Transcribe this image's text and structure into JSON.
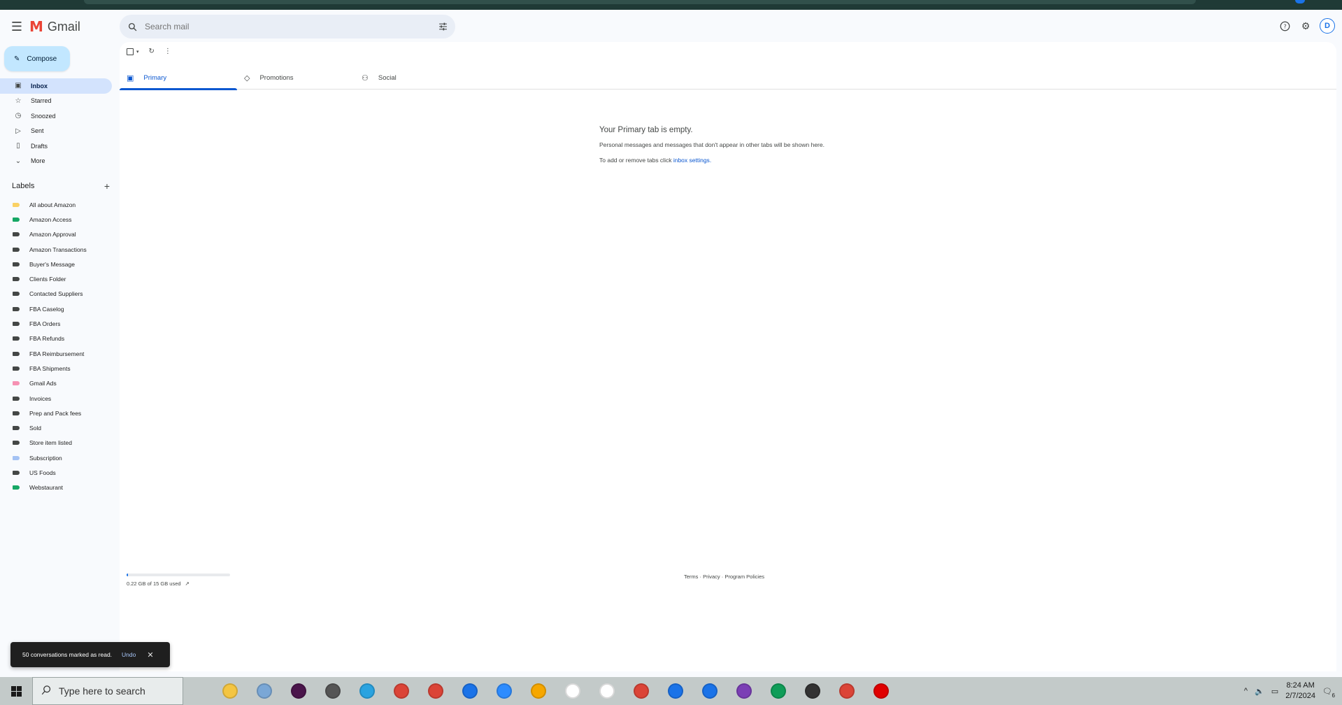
{
  "header": {
    "app_name": "Gmail",
    "search_placeholder": "Search mail",
    "avatar_letter": "D"
  },
  "sidebar": {
    "compose_label": "Compose",
    "nav": [
      {
        "label": "Inbox",
        "icon": "inbox-icon"
      },
      {
        "label": "Starred",
        "icon": "star-icon"
      },
      {
        "label": "Snoozed",
        "icon": "clock-icon"
      },
      {
        "label": "Sent",
        "icon": "send-icon"
      },
      {
        "label": "Drafts",
        "icon": "draft-icon"
      },
      {
        "label": "More",
        "icon": "chevron-down-icon"
      }
    ],
    "labels_title": "Labels",
    "labels": [
      {
        "name": "All about Amazon",
        "color": "#fad165"
      },
      {
        "name": "Amazon Access",
        "color": "#16a765"
      },
      {
        "name": "Amazon Approval",
        "color": "#444746"
      },
      {
        "name": "Amazon Transactions",
        "color": "#444746"
      },
      {
        "name": "Buyer's Message",
        "color": "#444746"
      },
      {
        "name": "Clients Folder",
        "color": "#444746"
      },
      {
        "name": "Contacted Suppliers",
        "color": "#444746"
      },
      {
        "name": "FBA Caselog",
        "color": "#444746"
      },
      {
        "name": "FBA Orders",
        "color": "#444746"
      },
      {
        "name": "FBA Refunds",
        "color": "#444746"
      },
      {
        "name": "FBA Reimbursement",
        "color": "#444746"
      },
      {
        "name": "FBA Shipments",
        "color": "#444746"
      },
      {
        "name": "Gmail Ads",
        "color": "#f691b3"
      },
      {
        "name": "Invoices",
        "color": "#444746"
      },
      {
        "name": "Prep and Pack fees",
        "color": "#444746"
      },
      {
        "name": "Sold",
        "color": "#444746"
      },
      {
        "name": "Store item listed",
        "color": "#444746"
      },
      {
        "name": "Subscription",
        "color": "#a4c2f4"
      },
      {
        "name": "US Foods",
        "color": "#444746"
      },
      {
        "name": "Webstaurant",
        "color": "#16a765"
      }
    ]
  },
  "tabs": [
    {
      "label": "Primary",
      "icon": "inbox-icon"
    },
    {
      "label": "Promotions",
      "icon": "tag-icon"
    },
    {
      "label": "Social",
      "icon": "people-icon"
    }
  ],
  "empty_state": {
    "title": "Your Primary tab is empty.",
    "description": "Personal messages and messages that don't appear in other tabs will be shown here.",
    "settings_prefix": "To add or remove tabs click ",
    "settings_link": "inbox settings",
    "settings_suffix": "."
  },
  "storage": {
    "text": "0.22 GB of 15 GB used",
    "fraction": 0.015
  },
  "footer": {
    "links": "Terms · Privacy · Program Policies"
  },
  "snackbar": {
    "message": "50 conversations marked as read.",
    "undo": "Undo"
  },
  "taskbar": {
    "search_placeholder": "Type here to search",
    "time": "8:24 AM",
    "date": "2/7/2024",
    "notification_count": "6",
    "apps": [
      {
        "name": "file-explorer-icon",
        "color": "#f4c542"
      },
      {
        "name": "notepad-icon",
        "color": "#7aa7d6"
      },
      {
        "name": "slack-icon",
        "color": "#4a154b"
      },
      {
        "name": "calculator-icon",
        "color": "#555555"
      },
      {
        "name": "telegram-icon",
        "color": "#2aa3e0"
      },
      {
        "name": "chrome-icon",
        "color": "#db4437"
      },
      {
        "name": "chrome-profile-icon",
        "color": "#db4437"
      },
      {
        "name": "chrome-k-icon",
        "color": "#1a73e8"
      },
      {
        "name": "zoom-icon",
        "color": "#2d8cff"
      },
      {
        "name": "rakuten-icon",
        "color": "#f6a700"
      },
      {
        "name": "chart-app-icon",
        "color": "#ffffff"
      },
      {
        "name": "chart-app-2-icon",
        "color": "#ffffff"
      },
      {
        "name": "chrome-c-icon",
        "color": "#db4437"
      },
      {
        "name": "chrome-mu-icon",
        "color": "#1a73e8"
      },
      {
        "name": "chrome-k2-icon",
        "color": "#1a73e8"
      },
      {
        "name": "chrome-person-icon",
        "color": "#7b3fb5"
      },
      {
        "name": "chrome-green-icon",
        "color": "#0f9d58"
      },
      {
        "name": "chrome-dark-icon",
        "color": "#333333"
      },
      {
        "name": "chrome-red-icon",
        "color": "#db4437"
      },
      {
        "name": "record-icon",
        "color": "#e00000"
      }
    ]
  }
}
